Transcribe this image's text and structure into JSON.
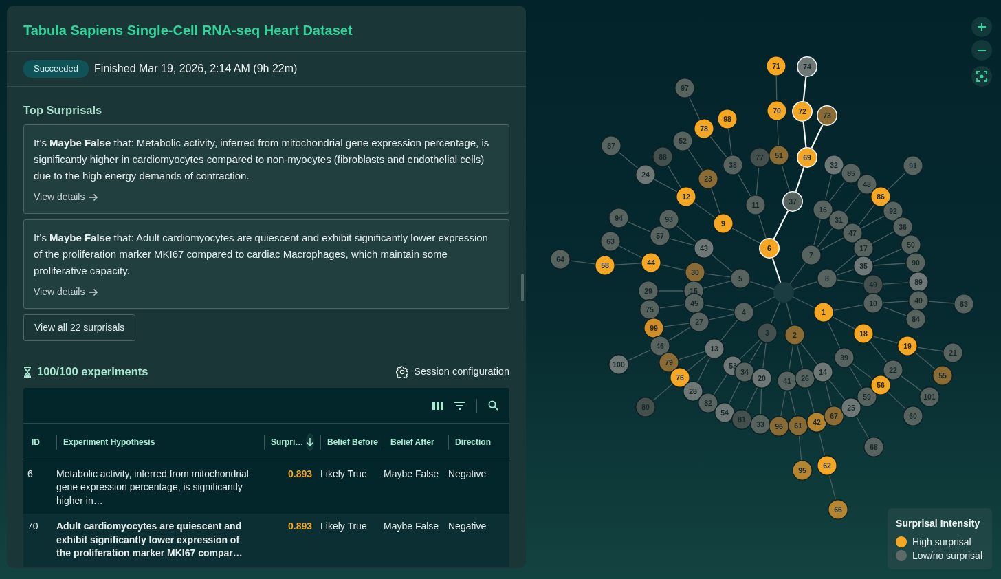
{
  "title": "Tabula Sapiens Single-Cell RNA-seq Heart Dataset",
  "status": {
    "badge": "Succeeded",
    "finished": "Finished Mar 19, 2026, 2:14 AM (9h 22m)"
  },
  "top_surprisals": {
    "heading": "Top Surprisals",
    "items": [
      {
        "text": "It’s **Maybe False** that: Metabolic activity, inferred from mitochondrial gene expression percentage, is significantly higher in cardiomyocytes compared to non-myocytes (fibroblasts and endothelial cells) due to the high energy demands of contraction.",
        "link": "View details"
      },
      {
        "text": "It’s **Maybe False** that: Adult cardiomyocytes are quiescent and exhibit significantly lower expression of the proliferation marker MKI67 compared to cardiac Macrophages, which maintain some proliferative capacity.",
        "link": "View details"
      }
    ],
    "view_all": "View all 22 surprisals"
  },
  "experiments": {
    "count": "100/100 experiments",
    "config": "Session configuration",
    "columns": [
      {
        "label": "ID",
        "sorted": false
      },
      {
        "label": "Experiment Hypothesis",
        "sorted": false
      },
      {
        "label": "Surpri…",
        "sorted": true
      },
      {
        "label": "Belief Before",
        "sorted": false
      },
      {
        "label": "Belief After",
        "sorted": false
      },
      {
        "label": "Direction",
        "sorted": false
      }
    ],
    "rows": [
      {
        "id": "6",
        "hypothesis": "Metabolic activity, inferred from mitochondrial gene expression percentage, is significantly higher in…",
        "surprisal": "0.893",
        "belief_before": "Likely True",
        "belief_after": "Maybe False",
        "direction": "Negative",
        "selected": false
      },
      {
        "id": "70",
        "hypothesis": "Adult cardiomyocytes are quiescent and exhibit significantly lower expression of the proliferation marker MKI67 compar…",
        "surprisal": "0.893",
        "belief_before": "Likely True",
        "belief_after": "Maybe False",
        "direction": "Negative",
        "selected": true
      }
    ]
  },
  "graph": {
    "nodes": [
      {
        "label": "5",
        "color": "#57635f",
        "highlighted": false,
        "children": [
          {
            "label": "30",
            "color": "#8a6b34",
            "highlighted": false,
            "children": [
              {
                "label": "44",
                "color": "#f5a623",
                "highlighted": false,
                "children": [
                  {
                    "label": "58",
                    "color": "#f5a623",
                    "highlighted": false,
                    "children": [
                      {
                        "label": "64",
                        "color": "#57635f",
                        "highlighted": false
                      }
                    ]
                  },
                  {
                    "label": "63",
                    "color": "#57635f",
                    "highlighted": false
                  }
                ]
              }
            ]
          },
          {
            "label": "43",
            "color": "#6d7876",
            "highlighted": false,
            "children": [
              {
                "label": "57",
                "color": "#57635f",
                "highlighted": false,
                "children": [
                  {
                    "label": "94",
                    "color": "#57635f",
                    "highlighted": false
                  }
                ]
              },
              {
                "label": "93",
                "color": "#57635f",
                "highlighted": false
              }
            ]
          },
          {
            "label": "15",
            "color": "#57635f",
            "highlighted": false,
            "children": [
              {
                "label": "29",
                "color": "#57635f",
                "highlighted": false
              }
            ]
          }
        ]
      },
      {
        "label": "6",
        "color": "#f5a623",
        "highlighted": true,
        "children": [
          {
            "label": "9",
            "color": "#f5a623",
            "highlighted": false,
            "children": [
              {
                "label": "12",
                "color": "#f5a623",
                "highlighted": false,
                "children": [
                  {
                    "label": "24",
                    "color": "#6d7876",
                    "highlighted": false,
                    "children": [
                      {
                        "label": "87",
                        "color": "#57635f",
                        "highlighted": false
                      }
                    ]
                  },
                  {
                    "label": "88",
                    "color": "#44504e",
                    "highlighted": false
                  }
                ]
              },
              {
                "label": "23",
                "color": "#8a6b34",
                "highlighted": false,
                "children": [
                  {
                    "label": "52",
                    "color": "#57635f",
                    "highlighted": false
                  }
                ]
              }
            ]
          },
          {
            "label": "11",
            "color": "#57635f",
            "highlighted": false,
            "children": [
              {
                "label": "38",
                "color": "#57635f",
                "highlighted": false,
                "children": [
                  {
                    "label": "78",
                    "color": "#f5a623",
                    "highlighted": false,
                    "children": [
                      {
                        "label": "97",
                        "color": "#57635f",
                        "highlighted": false
                      }
                    ]
                  },
                  {
                    "label": "98",
                    "color": "#f5a623",
                    "highlighted": false
                  }
                ]
              },
              {
                "label": "77",
                "color": "#44504e",
                "highlighted": false
              }
            ]
          },
          {
            "label": "37",
            "color": "#57635f",
            "highlighted": true,
            "children": [
              {
                "label": "51",
                "color": "#8a6b34",
                "highlighted": false,
                "children": [
                  {
                    "label": "70",
                    "color": "#f5a623",
                    "highlighted": false,
                    "children": [
                      {
                        "label": "71",
                        "color": "#f5a623",
                        "highlighted": false
                      }
                    ]
                  }
                ]
              },
              {
                "label": "69",
                "color": "#f5a623",
                "highlighted": true,
                "children": [
                  {
                    "label": "72",
                    "color": "#f5a623",
                    "highlighted": true,
                    "children": [
                      {
                        "label": "74",
                        "color": "#6d7876",
                        "highlighted": true
                      }
                    ]
                  },
                  {
                    "label": "73",
                    "color": "#8a6b34",
                    "highlighted": true
                  }
                ]
              }
            ]
          }
        ]
      },
      {
        "label": "7",
        "color": "#57635f",
        "highlighted": false,
        "children": [
          {
            "label": "16",
            "color": "#57635f",
            "highlighted": false,
            "children": [
              {
                "label": "32",
                "color": "#6d7876",
                "highlighted": false
              },
              {
                "label": "85",
                "color": "#57635f",
                "highlighted": false
              }
            ]
          },
          {
            "label": "31",
            "color": "#57635f",
            "highlighted": false,
            "children": [
              {
                "label": "48",
                "color": "#57635f",
                "highlighted": false
              }
            ]
          },
          {
            "label": "47",
            "color": "#57635f",
            "highlighted": false,
            "children": [
              {
                "label": "86",
                "color": "#f5a623",
                "highlighted": false,
                "children": [
                  {
                    "label": "91",
                    "color": "#57635f",
                    "highlighted": false
                  }
                ]
              },
              {
                "label": "92",
                "color": "#57635f",
                "highlighted": false
              }
            ]
          }
        ]
      },
      {
        "label": "8",
        "color": "#57635f",
        "highlighted": false,
        "children": [
          {
            "label": "17",
            "color": "#57635f",
            "highlighted": false,
            "children": [
              {
                "label": "36",
                "color": "#57635f",
                "highlighted": false
              }
            ]
          },
          {
            "label": "35",
            "color": "#6d7876",
            "highlighted": false,
            "children": [
              {
                "label": "50",
                "color": "#57635f",
                "highlighted": false
              },
              {
                "label": "90",
                "color": "#57635f",
                "highlighted": false
              }
            ]
          },
          {
            "label": "49",
            "color": "#44504e",
            "highlighted": false,
            "children": [
              {
                "label": "89",
                "color": "#6d7876",
                "highlighted": false
              }
            ]
          }
        ]
      },
      {
        "label": "4",
        "color": "#57635f",
        "highlighted": false,
        "children": [
          {
            "label": "45",
            "color": "#57635f",
            "highlighted": false,
            "children": [
              {
                "label": "75",
                "color": "#57635f",
                "highlighted": false
              }
            ]
          },
          {
            "label": "27",
            "color": "#57635f",
            "highlighted": false,
            "children": [
              {
                "label": "99",
                "color": "#d08d29",
                "highlighted": false
              },
              {
                "label": "46",
                "color": "#57635f",
                "highlighted": false,
                "children": [
                  {
                    "label": "100",
                    "color": "#6d7876",
                    "highlighted": false
                  }
                ]
              }
            ]
          },
          {
            "label": "13",
            "color": "#6d7876",
            "highlighted": false,
            "children": [
              {
                "label": "79",
                "color": "#8a6b34",
                "highlighted": false
              },
              {
                "label": "76",
                "color": "#f5a623",
                "highlighted": false,
                "children": [
                  {
                    "label": "80",
                    "color": "#44504e",
                    "highlighted": false
                  }
                ]
              },
              {
                "label": "28",
                "color": "#6d7876",
                "highlighted": false
              }
            ]
          }
        ]
      },
      {
        "label": "3",
        "color": "#44504e",
        "highlighted": false,
        "children": [
          {
            "label": "53",
            "color": "#6d7876",
            "highlighted": false,
            "children": [
              {
                "label": "82",
                "color": "#57635f",
                "highlighted": false
              }
            ]
          },
          {
            "label": "34",
            "color": "#57635f",
            "highlighted": false,
            "children": [
              {
                "label": "54",
                "color": "#6d7876",
                "highlighted": false
              }
            ]
          },
          {
            "label": "20",
            "color": "#6d7876",
            "highlighted": false,
            "children": [
              {
                "label": "81",
                "color": "#44504e",
                "highlighted": false
              },
              {
                "label": "33",
                "color": "#57635f",
                "highlighted": false
              }
            ]
          }
        ]
      },
      {
        "label": "2",
        "color": "#8a6b34",
        "highlighted": false,
        "children": [
          {
            "label": "41",
            "color": "#57635f",
            "highlighted": false,
            "children": [
              {
                "label": "96",
                "color": "#8a6b34",
                "highlighted": false
              },
              {
                "label": "61",
                "color": "#8a6b34",
                "highlighted": false,
                "children": [
                  {
                    "label": "95",
                    "color": "#b5852f",
                    "highlighted": false
                  }
                ]
              }
            ]
          },
          {
            "label": "26",
            "color": "#57635f",
            "highlighted": false,
            "children": [
              {
                "label": "42",
                "color": "#b5852f",
                "highlighted": false,
                "children": [
                  {
                    "label": "62",
                    "color": "#f5a623",
                    "highlighted": false,
                    "children": [
                      {
                        "label": "66",
                        "color": "#b5852f",
                        "highlighted": false
                      }
                    ]
                  }
                ]
              }
            ]
          },
          {
            "label": "14",
            "color": "#6d7876",
            "highlighted": false,
            "children": [
              {
                "label": "67",
                "color": "#8a6b34",
                "highlighted": false
              },
              {
                "label": "25",
                "color": "#6d7876",
                "highlighted": false,
                "children": [
                  {
                    "label": "68",
                    "color": "#57635f",
                    "highlighted": false
                  }
                ]
              }
            ]
          }
        ]
      },
      {
        "label": "1",
        "color": "#f5a623",
        "highlighted": false,
        "children": [
          {
            "label": "10",
            "color": "#57635f",
            "highlighted": false,
            "children": [
              {
                "label": "40",
                "color": "#57635f",
                "highlighted": false,
                "children": [
                  {
                    "label": "83",
                    "color": "#57635f",
                    "highlighted": false
                  }
                ]
              },
              {
                "label": "84",
                "color": "#57635f",
                "highlighted": false
              }
            ]
          },
          {
            "label": "39",
            "color": "#57635f",
            "highlighted": false,
            "children": [
              {
                "label": "59",
                "color": "#57635f",
                "highlighted": false
              },
              {
                "label": "56",
                "color": "#f5a623",
                "highlighted": false,
                "children": [
                  {
                    "label": "60",
                    "color": "#57635f",
                    "highlighted": false
                  }
                ]
              }
            ]
          },
          {
            "label": "18",
            "color": "#f5a623",
            "highlighted": false,
            "children": [
              {
                "label": "19",
                "color": "#f5a623",
                "highlighted": false,
                "children": [
                  {
                    "label": "21",
                    "color": "#57635f",
                    "highlighted": false
                  },
                  {
                    "label": "55",
                    "color": "#8a6b34",
                    "highlighted": false
                  }
                ]
              },
              {
                "label": "22",
                "color": "#57635f",
                "highlighted": false,
                "children": [
                  {
                    "label": "101",
                    "color": "#57635f",
                    "highlighted": false
                  }
                ]
              }
            ]
          }
        ]
      }
    ]
  },
  "legend": {
    "title": "Surprisal Intensity",
    "items": [
      {
        "label": "High surprisal",
        "color": "#f5a623"
      },
      {
        "label": "Low/no surprisal",
        "color": "#5f6b69"
      }
    ]
  }
}
